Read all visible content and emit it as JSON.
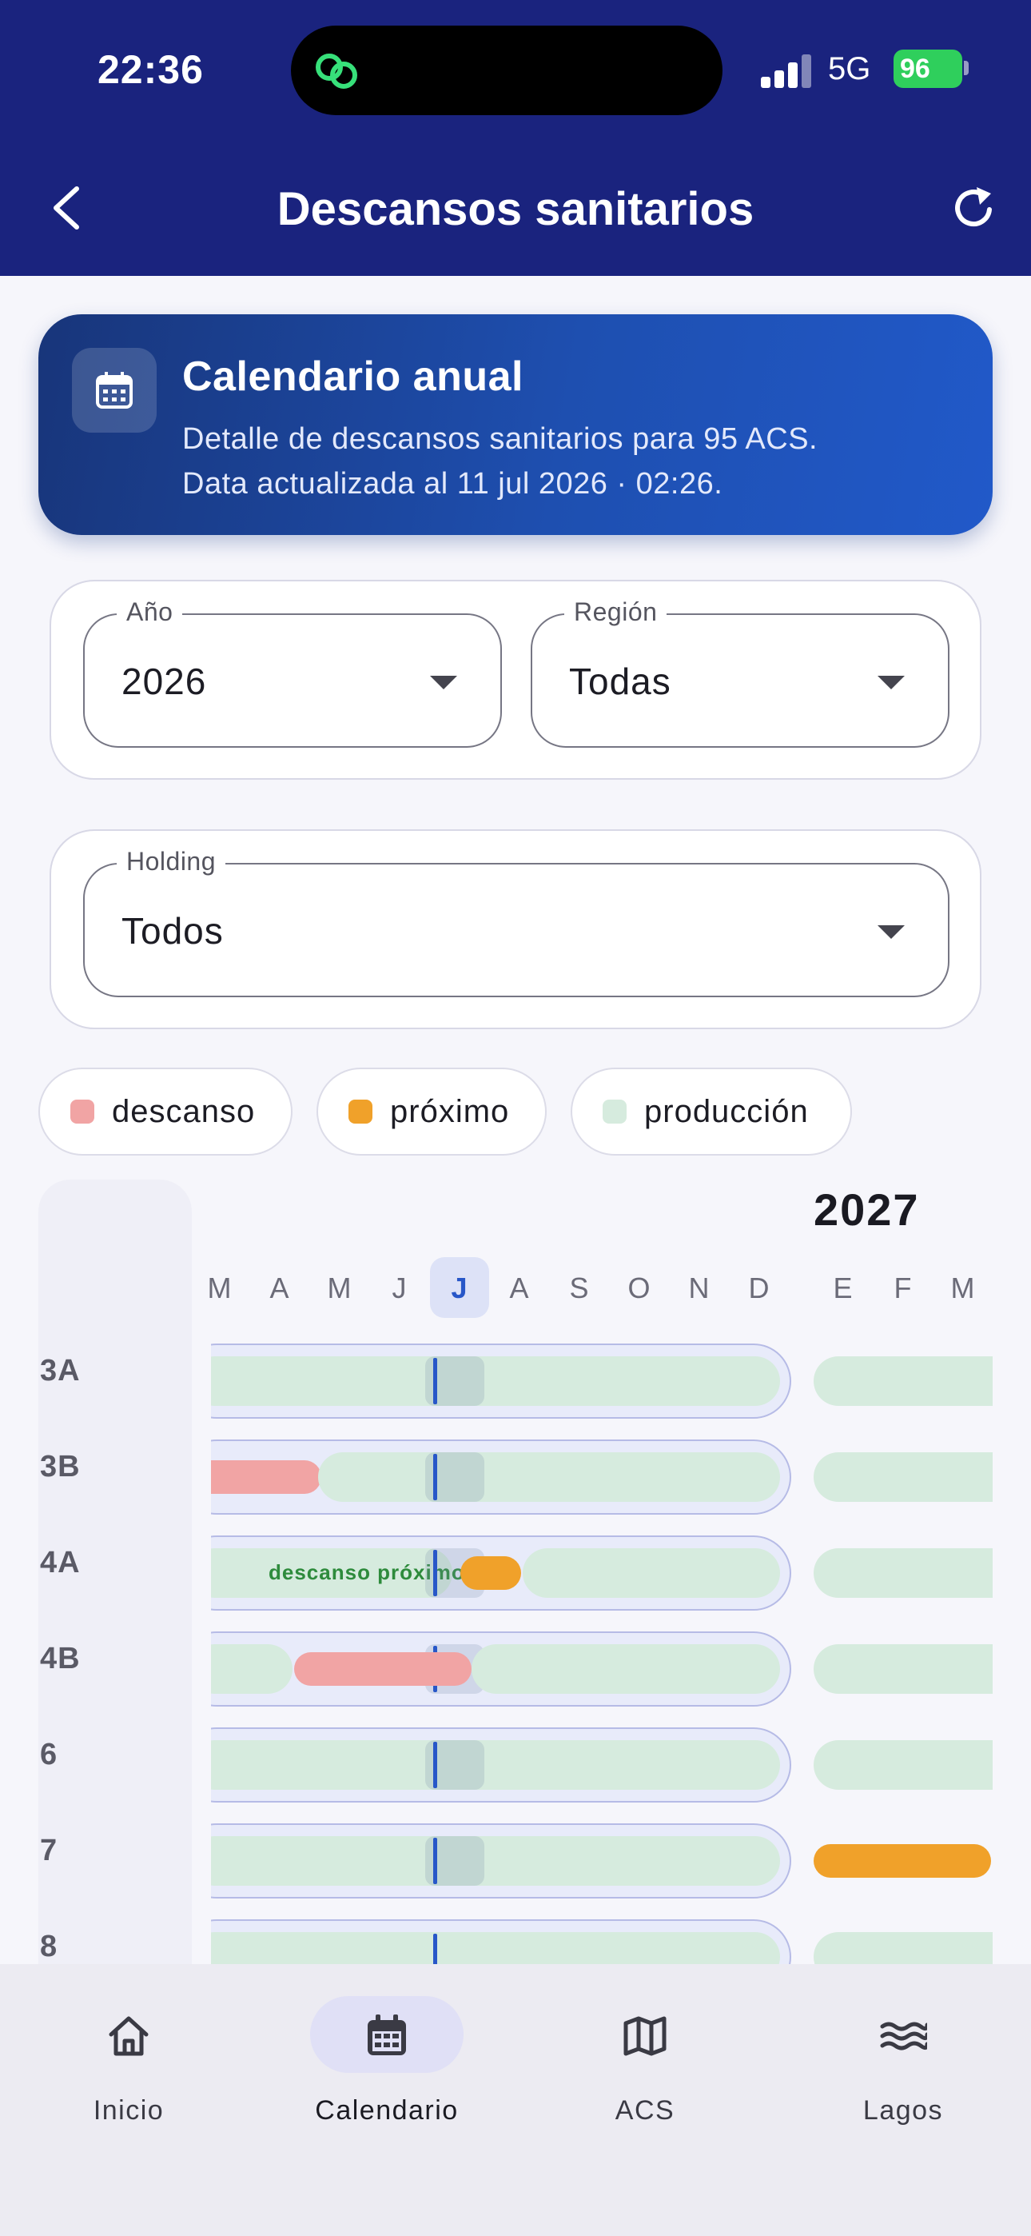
{
  "status": {
    "time": "22:36",
    "network": "5G",
    "battery": "96"
  },
  "appbar": {
    "title": "Descansos sanitarios"
  },
  "hero": {
    "title": "Calendario anual",
    "line1": "Detalle de descansos sanitarios para 95 ACS.",
    "line2": "Data actualizada al 11 jul 2026 · 02:26."
  },
  "filters": {
    "year": {
      "label": "Año",
      "value": "2026"
    },
    "region": {
      "label": "Región",
      "value": "Todas"
    },
    "holding": {
      "label": "Holding",
      "value": "Todos"
    }
  },
  "legend": [
    {
      "label": "descanso",
      "color": "#f1a4a4"
    },
    {
      "label": "próximo",
      "color": "#f0a12a"
    },
    {
      "label": "producción",
      "color": "#d6ebde"
    }
  ],
  "calendar": {
    "next_year": "2027",
    "months": [
      "M",
      "A",
      "M",
      "J",
      "J",
      "A",
      "S",
      "O",
      "N",
      "D",
      "E",
      "F",
      "M"
    ],
    "current_month_index": 4,
    "rows": [
      "3A",
      "3B",
      "4A",
      "4B",
      "6",
      "7",
      "8"
    ],
    "inline_label": "descanso próximo"
  },
  "nav": [
    {
      "label": "Inicio",
      "icon": "home-icon",
      "active": false
    },
    {
      "label": "Calendario",
      "icon": "calendar-icon",
      "active": true
    },
    {
      "label": "ACS",
      "icon": "map-icon",
      "active": false
    },
    {
      "label": "Lagos",
      "icon": "waves-icon",
      "active": false
    }
  ],
  "colors": {
    "primary": "#1a237e",
    "descanso": "#f1a4a4",
    "proximo": "#f0a12a",
    "produccion": "#d6ebde",
    "today": "#2857c8"
  }
}
